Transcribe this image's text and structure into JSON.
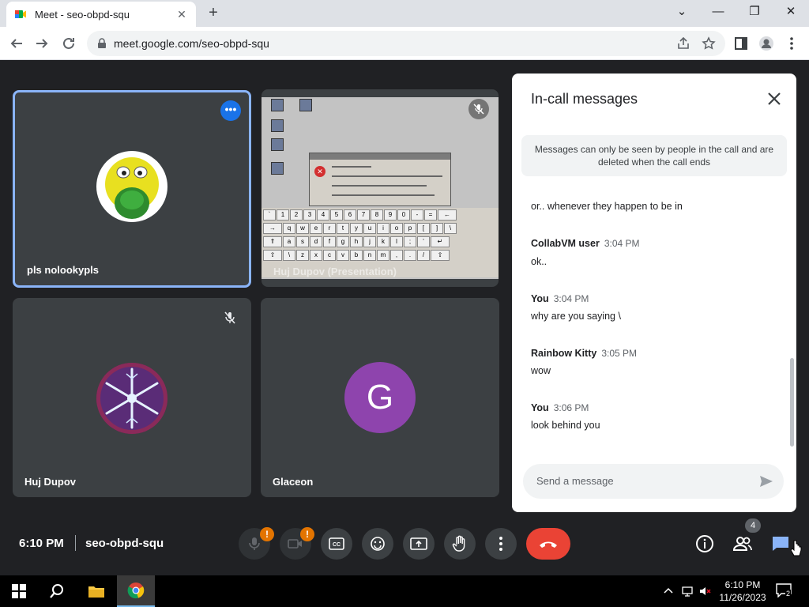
{
  "browser": {
    "tab_title": "Meet - seo-obpd-squ",
    "url": "meet.google.com/seo-obpd-squ"
  },
  "tiles": [
    {
      "name": "pls nolookypls"
    },
    {
      "name": "Huj Dupov (Presentation)"
    },
    {
      "name": "Huj Dupov"
    },
    {
      "name": "Glaceon",
      "avatar_letter": "G",
      "avatar_color": "#8e44ad"
    }
  ],
  "chat": {
    "title": "In-call messages",
    "notice": "Messages can only be seen by people in the call and are deleted when the call ends",
    "messages": [
      {
        "text": "or.. whenever they happen to be in"
      },
      {
        "sender": "CollabVM user",
        "time": "3:04 PM",
        "text": "ok.."
      },
      {
        "sender": "You",
        "time": "3:04 PM",
        "text": "why are you saying \\"
      },
      {
        "sender": "Rainbow Kitty",
        "time": "3:05 PM",
        "text": "wow"
      },
      {
        "sender": "You",
        "time": "3:06 PM",
        "text": "look behind you"
      }
    ],
    "input_placeholder": "Send a message"
  },
  "controls": {
    "time": "6:10 PM",
    "meeting_code": "seo-obpd-squ",
    "people_count": "4",
    "colors": {
      "end_call": "#ea4335",
      "warning": "#e37400",
      "accent": "#1a73e8"
    }
  },
  "taskbar": {
    "time": "6:10 PM",
    "date": "11/26/2023",
    "notification_count": "2"
  }
}
